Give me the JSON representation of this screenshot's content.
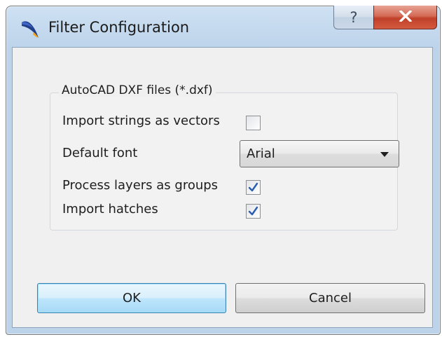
{
  "window": {
    "title": "Filter Configuration",
    "help_label": "?",
    "close_label": "x"
  },
  "group": {
    "title": "AutoCAD DXF files (*.dxf)",
    "import_strings_label": "Import strings as vectors",
    "import_strings_checked": false,
    "default_font_label": "Default font",
    "default_font_value": "Arial",
    "process_layers_label": "Process layers as groups",
    "process_layers_checked": true,
    "import_hatches_label": "Import hatches",
    "import_hatches_checked": true
  },
  "buttons": {
    "ok_label": "OK",
    "cancel_label": "Cancel"
  },
  "colors": {
    "check_mark": "#2a5db0",
    "ok_border": "#3c7fb1",
    "close_red": "#c0402a"
  },
  "icons": {
    "app": "quill-app-icon",
    "help": "question-mark-icon",
    "close": "close-x-icon",
    "dropdown": "chevron-down-icon",
    "check": "check-mark-icon"
  }
}
